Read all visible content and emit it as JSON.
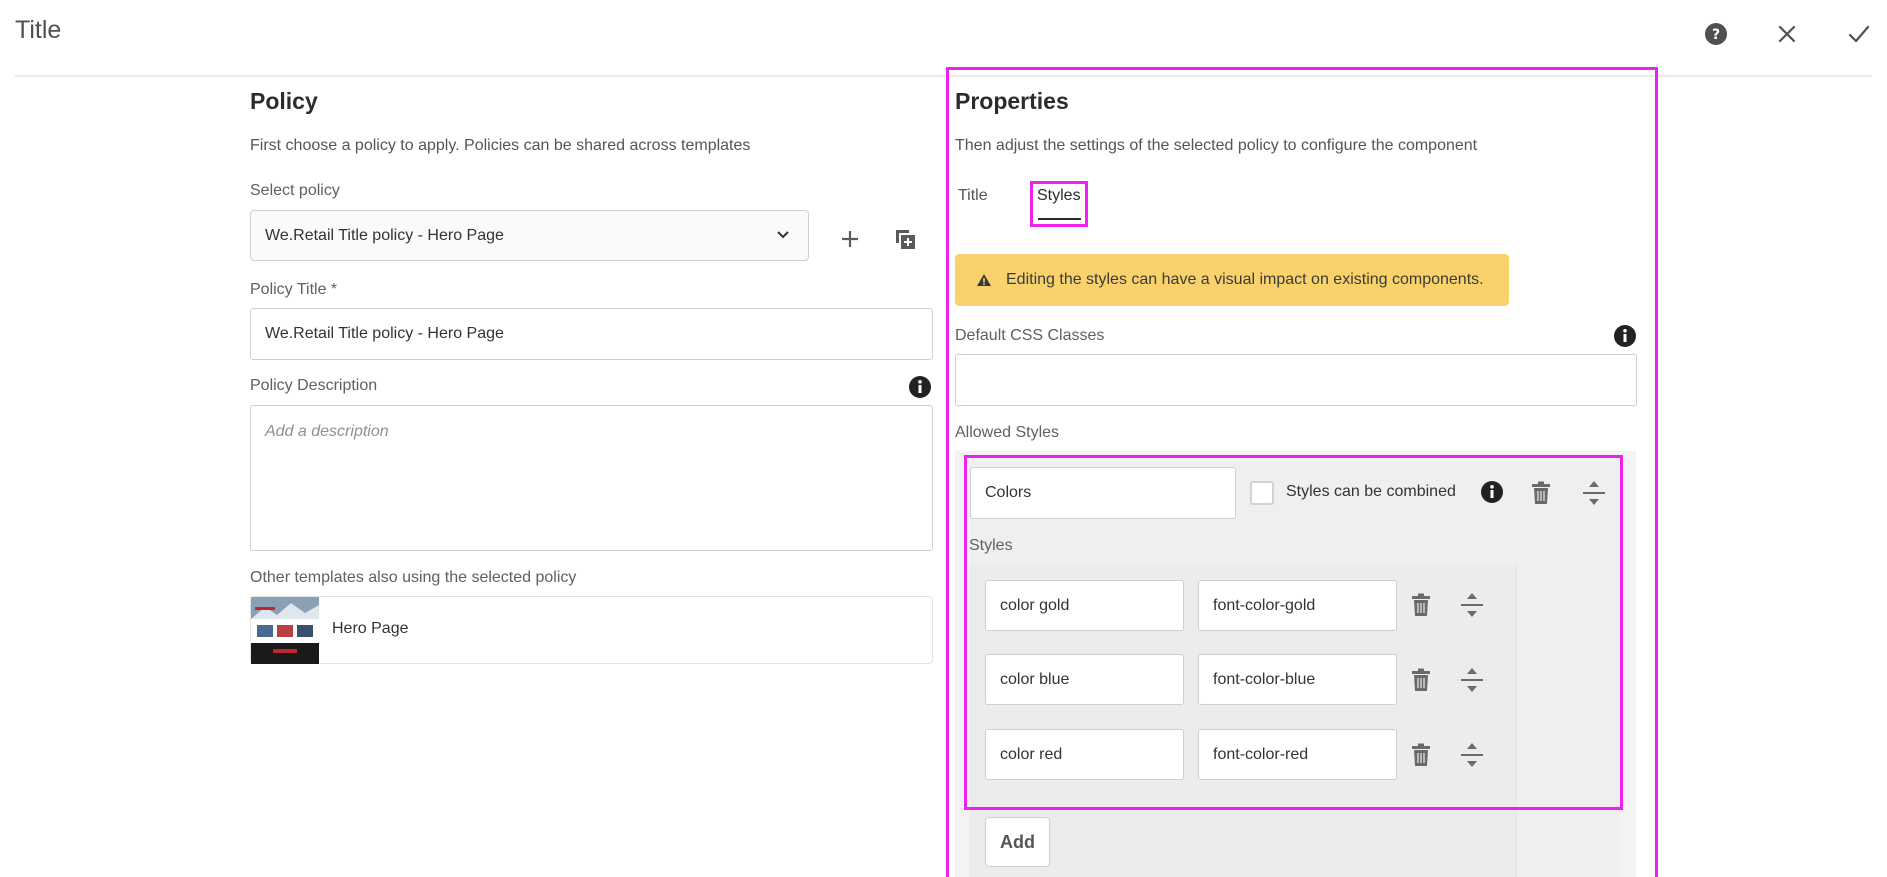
{
  "header": {
    "title": "Title",
    "help_icon": "help-circle-icon",
    "close_icon": "close-icon",
    "done_icon": "checkmark-icon"
  },
  "policy": {
    "heading": "Policy",
    "description": "First choose a policy to apply. Policies can be shared across templates",
    "select_label": "Select policy",
    "select_value": "We.Retail Title policy - Hero Page",
    "title_label": "Policy Title *",
    "title_value": "We.Retail Title policy - Hero Page",
    "description_label": "Policy Description",
    "description_placeholder": "Add a description",
    "other_templates_label": "Other templates also using the selected policy",
    "templates": [
      {
        "name": "Hero Page"
      }
    ]
  },
  "properties": {
    "heading": "Properties",
    "description": "Then adjust the settings of the selected policy to configure the component",
    "tabs": [
      {
        "label": "Title",
        "active": false
      },
      {
        "label": "Styles",
        "active": true
      }
    ],
    "warning": "Editing the styles can have a visual impact on existing components.",
    "default_css_label": "Default CSS Classes",
    "default_css_value": "",
    "allowed_styles_label": "Allowed Styles",
    "group": {
      "name": "Colors",
      "combine_label": "Styles can be combined",
      "combine_checked": false,
      "styles_label": "Styles",
      "styles": [
        {
          "name": "color gold",
          "css_class": "font-color-gold"
        },
        {
          "name": "color blue",
          "css_class": "font-color-blue"
        },
        {
          "name": "color red",
          "css_class": "font-color-red"
        }
      ]
    },
    "add_label": "Add"
  },
  "colors": {
    "highlight": "#ee22ee",
    "warning_bg": "#fad26b"
  }
}
